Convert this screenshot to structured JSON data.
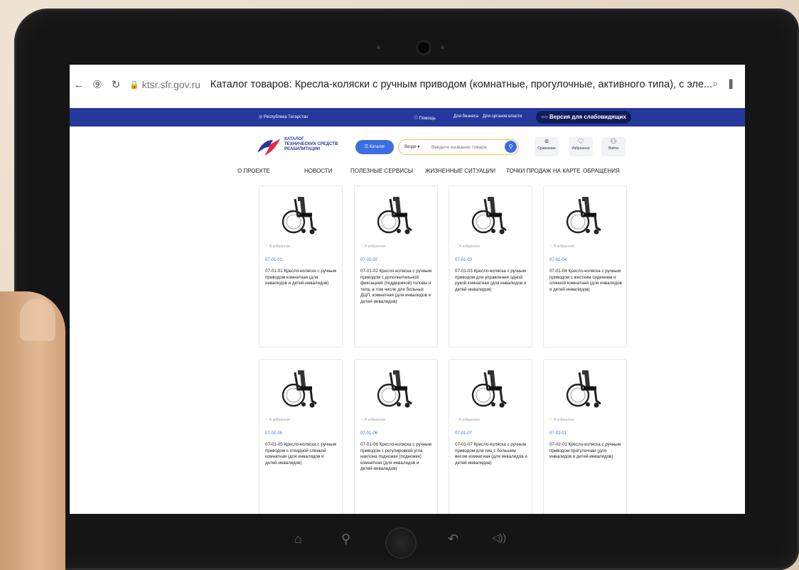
{
  "browser": {
    "url": "ktsr.sfr.gov.ru",
    "title": "Каталог товаров: Кресла-коляски с ручным приводом (комнатные, прогулочные, активного типа), с эле..."
  },
  "topbar": {
    "region": "Республика Татарстан",
    "help": "Помощь",
    "business": "Для бизнеса",
    "gov": "Для органов власти",
    "low_vision": "Версия для слабовидящих"
  },
  "logo": {
    "line1": "КАТАЛОГ",
    "line2": "ТЕХНИЧЕСКИХ СРЕДСТВ",
    "line3": "РЕАБИЛИТАЦИИ"
  },
  "header": {
    "catalog_label": "Каталог",
    "search_scope": "Везде",
    "search_placeholder": "Введите название товара",
    "compare_label": "Сравнение",
    "favorites_label": "Избранное",
    "login_label": "Войти"
  },
  "nav": [
    "О ПРОЕКТЕ",
    "НОВОСТИ",
    "ПОЛЕЗНЫЕ СЕРВИСЫ",
    "ЖИЗНЕННЫЕ СИТУАЦИИ",
    "ТОЧКИ ПРОДАЖ НА КАРТЕ",
    "ОБРАЩЕНИЯ"
  ],
  "fav_label": "В избранное",
  "products": [
    {
      "code": "07-01-01",
      "name": "07-01-01 Кресло-коляска с ручным приводом комнатная (для инвалидов и детей-инвалидов)"
    },
    {
      "code": "07-01-02",
      "name": "07-01-02 Кресло-коляска с ручным приводом с дополнительной фиксацией (поддержкой) головы и тела, в том числе для больных ДЦП, комнатная (для инвалидов и детей-инвалидов)"
    },
    {
      "code": "07-01-03",
      "name": "07-01-03 Кресло-коляска с ручным приводом для управления одной рукой комнатная (для инвалидов и детей-инвалидов)"
    },
    {
      "code": "07-01-04",
      "name": "07-01-04 Кресло-коляска с ручным приводом с жестким сидением и спинкой комнатная (для инвалидов и детей-инвалидов)"
    },
    {
      "code": "07-01-05",
      "name": "07-01-05 Кресло-коляска с ручным приводом с откидной спинкой комнатная (для инвалидов и детей-инвалидов)"
    },
    {
      "code": "07-01-06",
      "name": "07-01-06 Кресло-коляска с ручным приводом с регулировкой угла наклона подножки (подножек) комнатная (для инвалидов и детей-инвалидов)"
    },
    {
      "code": "07-01-07",
      "name": "07-01-07 Кресло-коляска с ручным приводом для лиц с большим весом комнатная (для инвалидов и детей-инвалидов)"
    },
    {
      "code": "07-02-01",
      "name": "07-02-01 Кресло-коляска с ручным приводом прогулочная (для инвалидов и детей-инвалидов)"
    }
  ],
  "colors": {
    "brand_blue": "#24399b",
    "accent_blue": "#3b6fe0",
    "search_border": "#f0c24b",
    "logo_red": "#e52c3c"
  }
}
